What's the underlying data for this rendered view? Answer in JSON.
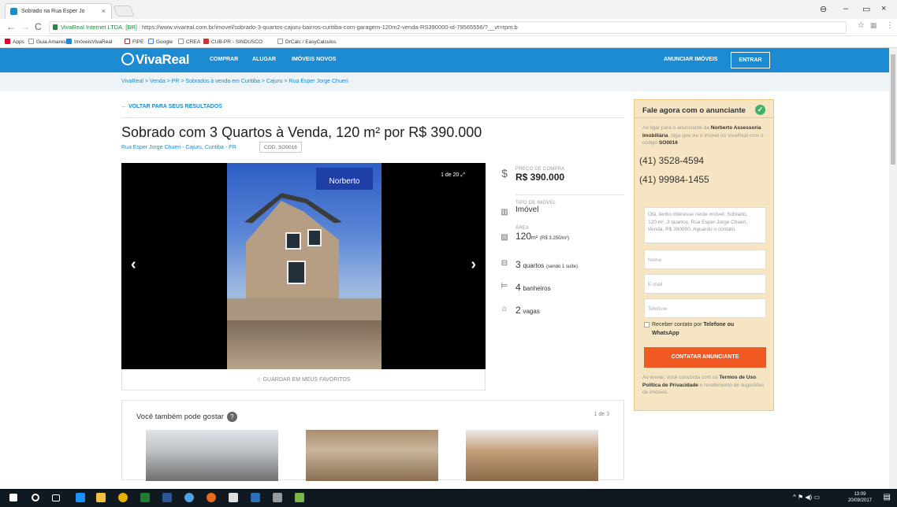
{
  "browser": {
    "tab_title": "Sobrado na Rua Esper Jo",
    "url_secure": "VivaReal Internet LTDA. [BR]",
    "url": "https://www.vivareal.com.br/imovel/sobrado-3-quartos-cajuru-bairros-curitiba-com-garagem-120m2-venda-RS390000-id-79565556/?__vt=rpm:b",
    "bookmarks": [
      "Apps",
      "Guia Amarela",
      "ImóveisVivaReal",
      "FIPE",
      "Google",
      "CREA",
      "CUB-PR - SINDUSCO",
      "DrCalc / EasyCalculos"
    ]
  },
  "header": {
    "logo": "VivaReal",
    "nav": [
      "COMPRAR",
      "ALUGAR",
      "IMÓVEIS NOVOS"
    ],
    "announce": "ANUNCIAR IMÓVEIS",
    "login": "ENTRAR"
  },
  "breadcrumb": "VivaReal > Venda > PR > Sobrados à venda em Curitiba > Cajuru > Rua Esper Jorge Chueri",
  "listing": {
    "back": "← VOLTAR PARA SEUS RESULTADOS",
    "title": "Sobrado com 3 Quartos à Venda, 120 m² por R$ 390.000",
    "address": "Rua Esper Jorge Chueri - Cajuru, Curitiba - PR",
    "code": "COD. SO0016",
    "gallery_counter": "1 de 20",
    "gallery_logo": "Norberto",
    "save_favorite": "☆ GUARDAR EM MEUS FAVORITOS"
  },
  "features": {
    "price_label": "PREÇO DE COMPRA",
    "price": "R$ 390.000",
    "type_label": "TIPO DE IMÓVEL",
    "type": "Imóvel",
    "area_label": "ÁREA",
    "area": "120",
    "area_unit": "m²",
    "area_price": "(R$ 3.250/m²)",
    "bedrooms": "3",
    "bedrooms_text": "quartos",
    "bedrooms_note": "(sendo 1 suíte)",
    "bathrooms": "4",
    "bathrooms_text": "banheiros",
    "parking": "2",
    "parking_text": "vagas"
  },
  "contact": {
    "title": "Fale agora com o anunciante",
    "intro_1": "Ao ligar para o anunciante da ",
    "agency": "Norberto Assessoria Imobiliária",
    "intro_2": ", diga que viu o imóvel no VivaReal com o código ",
    "code": "SO0016",
    "phone_1": "(41) 3528-4594",
    "phone_2": "(41) 99984-1455",
    "message": "Olá, tenho interesse neste imóvel: Sobrado, 120 m², 3 quartos, Rua Esper Jorge Chueri, Venda, R$ 390000. Aguardo o contato.",
    "name_placeholder": "Nome",
    "email_placeholder": "E-mail",
    "phone_placeholder": "Telefone",
    "checkbox_1": "Receber contato por ",
    "checkbox_bold": "Telefone ou WhatsApp",
    "cta": "CONTATAR ANUNCIANTE",
    "terms_1": "Ao enviar, você concorda com os ",
    "terms_bold_1": "Termos de Uso",
    "terms_2": ", ",
    "terms_bold_2": "Política de Privacidade",
    "terms_3": " e recebimento de sugestões de imóveis."
  },
  "suggestions": {
    "title": "Você também pode gostar",
    "count": "1 de 3"
  },
  "taskbar": {
    "time": "13:09",
    "date": "20/09/2017"
  }
}
